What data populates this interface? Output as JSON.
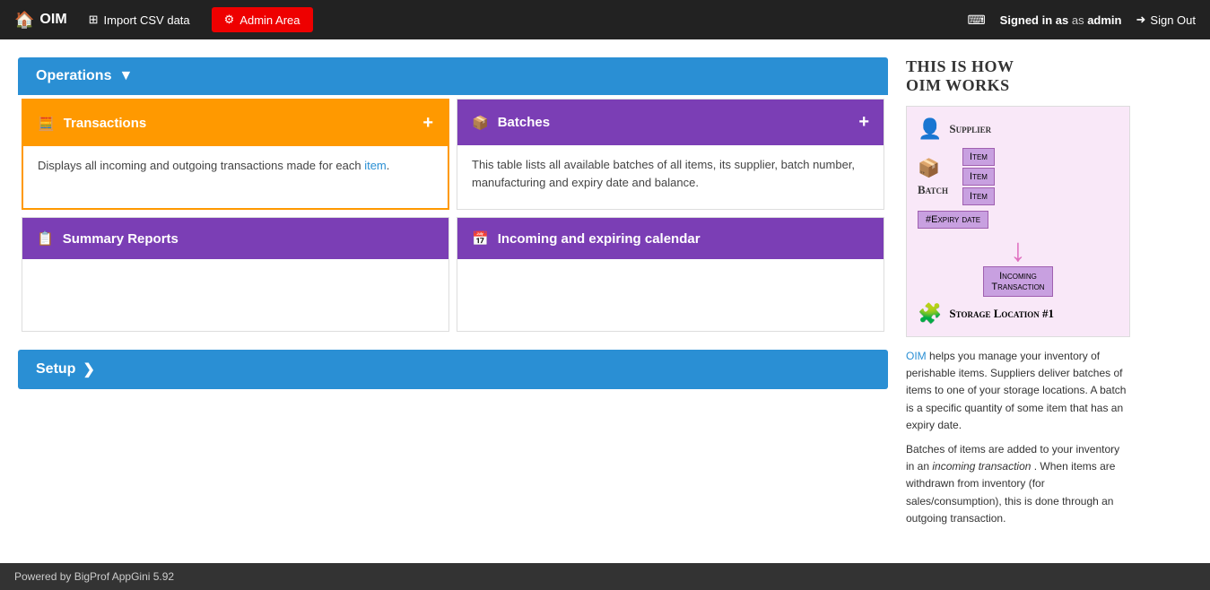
{
  "header": {
    "logo": "OIM",
    "logo_icon": "🏠",
    "import_btn": "Import CSV data",
    "import_icon": "⊞",
    "admin_btn": "Admin Area",
    "admin_icon": "⚙",
    "keyboard_icon": "⌨",
    "signed_in_prefix": "Signed in as",
    "admin_user": "admin",
    "signout_btn": "Sign Out",
    "signout_icon": "➜"
  },
  "operations": {
    "label": "Operations",
    "dropdown_icon": "▼"
  },
  "transactions_card": {
    "label": "Transactions",
    "icon": "🧮",
    "plus": "+",
    "description": "Displays all incoming and outgoing transactions made for each item.",
    "item_link": "item"
  },
  "batches_card": {
    "label": "Batches",
    "icon": "📦",
    "plus": "+",
    "description": "This table lists all available batches of all items, its supplier, batch number, manufacturing and expiry date and balance."
  },
  "summary_card": {
    "label": "Summary Reports",
    "icon": "📋"
  },
  "calendar_card": {
    "label": "Incoming and expiring calendar",
    "icon": "📅"
  },
  "setup": {
    "label": "Setup",
    "arrow_icon": "❯"
  },
  "right_panel": {
    "title": "This is how OIM works",
    "supplier_label": "Supplier",
    "supplier_icon": "👤",
    "item_labels": [
      "Item",
      "Item",
      "Item"
    ],
    "batch_label": "Batch",
    "expiry_label": "#Expiry date",
    "incoming_label": "Incoming Transaction",
    "storage_label": "Storage Location #1",
    "description_part1": " helps you manage your inventory of perishable items. Suppliers deliver batches of items to one of your storage locations. A batch is a specific quantity of some item that has an expiry date.",
    "description_part2": "Batches of items are added to your inventory in an ",
    "incoming_transaction_text": "incoming transaction",
    "description_part3": ". When items are withdrawn from inventory (for sales/consumption), this is done through an outgoing transaction."
  },
  "footer": {
    "label": "Powered by BigProf AppGini 5.92"
  },
  "colors": {
    "header_bg": "#222222",
    "blue_accent": "#2a8fd4",
    "orange": "#f90000",
    "admin_red": "#cc0000",
    "purple": "#7b3eb5",
    "operations_blue": "#2a8fd4"
  }
}
